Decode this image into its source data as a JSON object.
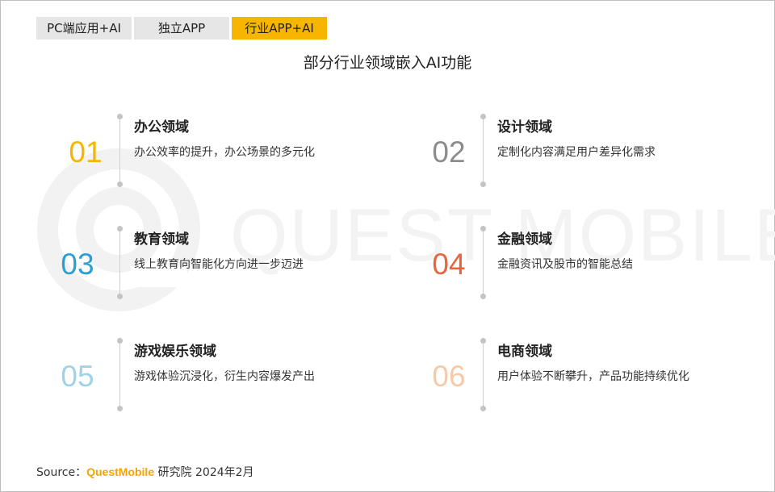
{
  "tabs": [
    {
      "label": "PC端应用+AI",
      "active": false
    },
    {
      "label": "独立APP",
      "active": false
    },
    {
      "label": "行业APP+AI",
      "active": true
    }
  ],
  "title": "部分行业领域嵌入AI功能",
  "watermark": "QUEST MOBILE",
  "items": [
    {
      "num": "01",
      "color": "#f7b500",
      "head": "办公领域",
      "desc": "办公效率的提升，办公场景的多元化"
    },
    {
      "num": "02",
      "color": "#8c8c8c",
      "head": "设计领域",
      "desc": "定制化内容满足用户差异化需求"
    },
    {
      "num": "03",
      "color": "#2b9fd4",
      "head": "教育领域",
      "desc": "线上教育向智能化方向进一步迈进"
    },
    {
      "num": "04",
      "color": "#e8643c",
      "head": "金融领域",
      "desc": "金融资讯及股市的智能总结"
    },
    {
      "num": "05",
      "color": "#9fd3e6",
      "head": "游戏娱乐领域",
      "desc": "游戏体验沉浸化，衍生内容爆发产出"
    },
    {
      "num": "06",
      "color": "#f8c9a6",
      "head": "电商领域",
      "desc": "用户体验不断攀升，产品功能持续优化"
    }
  ],
  "source": {
    "prefix": "Source：",
    "brand": "QuestMobile",
    "suffix": " 研究院 2024年2月"
  }
}
